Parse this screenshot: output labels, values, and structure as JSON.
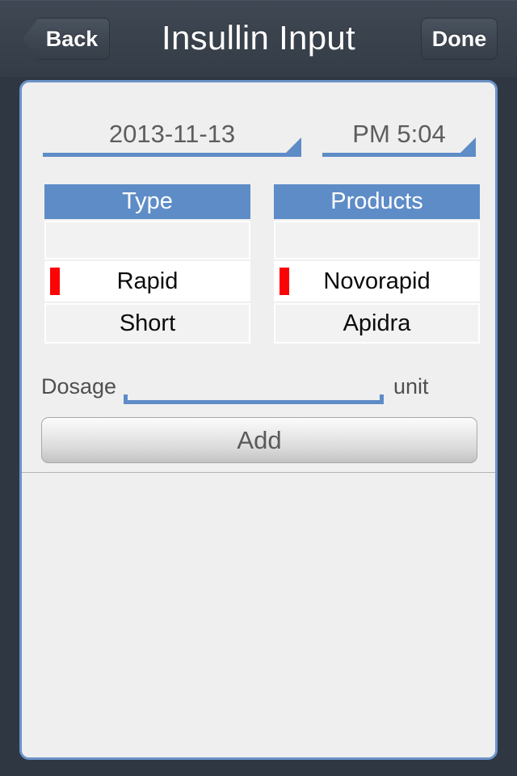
{
  "navbar": {
    "back_label": "Back",
    "title": "Insullin Input",
    "done_label": "Done"
  },
  "form": {
    "date": {
      "value": "2013-11-13",
      "caret_icon": "triangle-down-icon"
    },
    "time": {
      "value": "PM 5:04",
      "caret_icon": "triangle-down-icon"
    },
    "type_picker": {
      "header": "Type",
      "rows": [
        {
          "label": "",
          "selected": false
        },
        {
          "label": "Rapid",
          "selected": true
        },
        {
          "label": "Short",
          "selected": false
        }
      ]
    },
    "products_picker": {
      "header": "Products",
      "rows": [
        {
          "label": "",
          "selected": false
        },
        {
          "label": "Novorapid",
          "selected": true
        },
        {
          "label": "Apidra",
          "selected": false
        }
      ]
    },
    "dosage": {
      "label": "Dosage",
      "value": "",
      "placeholder": "",
      "unit_label": "unit"
    },
    "add_label": "Add"
  },
  "colors": {
    "accent_blue": "#5e8cc7",
    "panel_border": "#6c93ca",
    "navbar_bg": "#3a424d",
    "selected_marker_red": "#fb0406",
    "panel_bg": "#efefef"
  },
  "entries": []
}
